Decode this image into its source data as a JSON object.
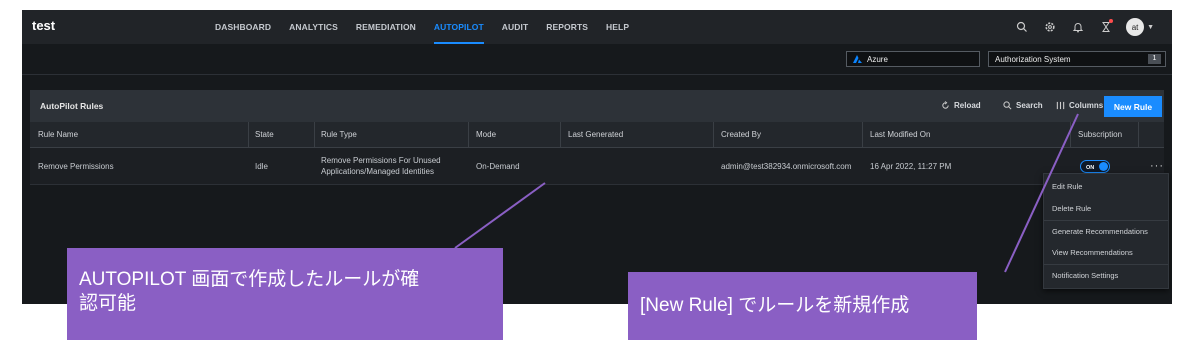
{
  "app": {
    "brand": "test"
  },
  "nav": [
    "DASHBOARD",
    "ANALYTICS",
    "REMEDIATION",
    "AUTOPILOT",
    "AUDIT",
    "REPORTS",
    "HELP"
  ],
  "nav_active": "AUTOPILOT",
  "user": {
    "avatar": "at"
  },
  "filters": {
    "cloud": "Azure",
    "auth_system": "Authorization System",
    "auth_count": "1"
  },
  "panel": {
    "title": "AutoPilot Rules",
    "reload": "Reload",
    "search": "Search",
    "columns": "Columns",
    "new_rule": "New Rule"
  },
  "table": {
    "headers": [
      "Rule Name",
      "State",
      "Rule Type",
      "Mode",
      "Last Generated",
      "Created By",
      "Last Modified On",
      "Subscription"
    ],
    "rows": [
      {
        "rule_name": "Remove Permissions",
        "state": "Idle",
        "rule_type_line1": "Remove Permissions For Unused",
        "rule_type_line2": "Applications/Managed Identities",
        "mode": "On-Demand",
        "last_generated": "",
        "created_by": "admin@test382934.onmicrosoft.com",
        "last_modified": "16 Apr 2022, 11:27 PM",
        "subscription": "ON"
      }
    ]
  },
  "context_menu": [
    "Edit Rule",
    "Delete Rule",
    "Generate Recommendations",
    "View Recommendations",
    "Notification Settings"
  ],
  "callouts": {
    "left_line1": "AUTOPILOT 画面で作成したルールが確",
    "left_line2": "認可能",
    "right": "[New Rule] でルールを新規作成"
  },
  "colors": {
    "accent": "#1a8cff",
    "callout": "#8a5fc4",
    "background": "#16191c"
  }
}
